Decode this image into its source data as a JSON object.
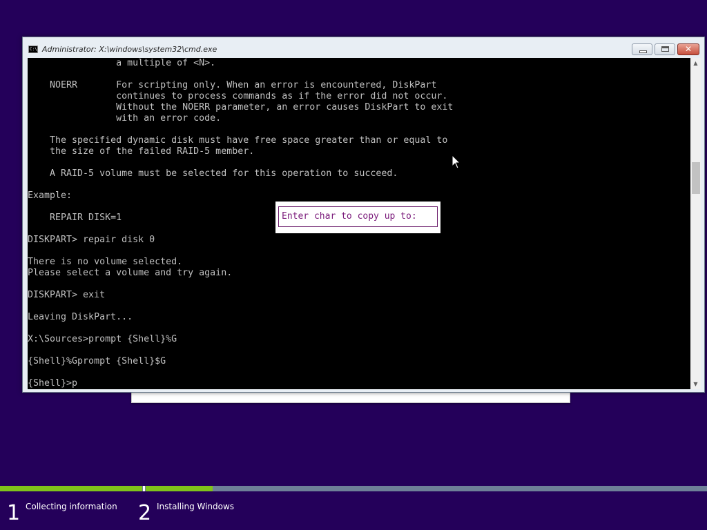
{
  "window": {
    "title": "Administrator: X:\\windows\\system32\\cmd.exe",
    "icon": "cmd-icon",
    "icon_text": "C:\\"
  },
  "console": {
    "lines": [
      "                a multiple of <N>.",
      "",
      "    NOERR       For scripting only. When an error is encountered, DiskPart",
      "                continues to process commands as if the error did not occur.",
      "                Without the NOERR parameter, an error causes DiskPart to exit",
      "                with an error code.",
      "",
      "    The specified dynamic disk must have free space greater than or equal to",
      "    the size of the failed RAID-5 member.",
      "",
      "    A RAID-5 volume must be selected for this operation to succeed.",
      "",
      "Example:",
      "",
      "    REPAIR DISK=1",
      "",
      "DISKPART> repair disk 0",
      "",
      "There is no volume selected.",
      "Please select a volume and try again.",
      "",
      "DISKPART> exit",
      "",
      "Leaving DiskPart...",
      "",
      "X:\\Sources>prompt {Shell}%G",
      "",
      "{Shell}%Gprompt {Shell}$G",
      "",
      "{Shell}>p"
    ]
  },
  "copy_prompt": {
    "text": "Enter char to copy up to:"
  },
  "setup_progress": {
    "steps": [
      {
        "number": "1",
        "label": "Collecting information",
        "completion": 1.0
      },
      {
        "number": "2",
        "label": "Installing Windows",
        "completion": 0.12
      }
    ],
    "accent_color": "#80c31a"
  },
  "colors": {
    "desktop_background": "#24005a",
    "console_background": "#000000",
    "console_text": "#c0c0c0",
    "prompt_text": "#7a1a7a"
  }
}
